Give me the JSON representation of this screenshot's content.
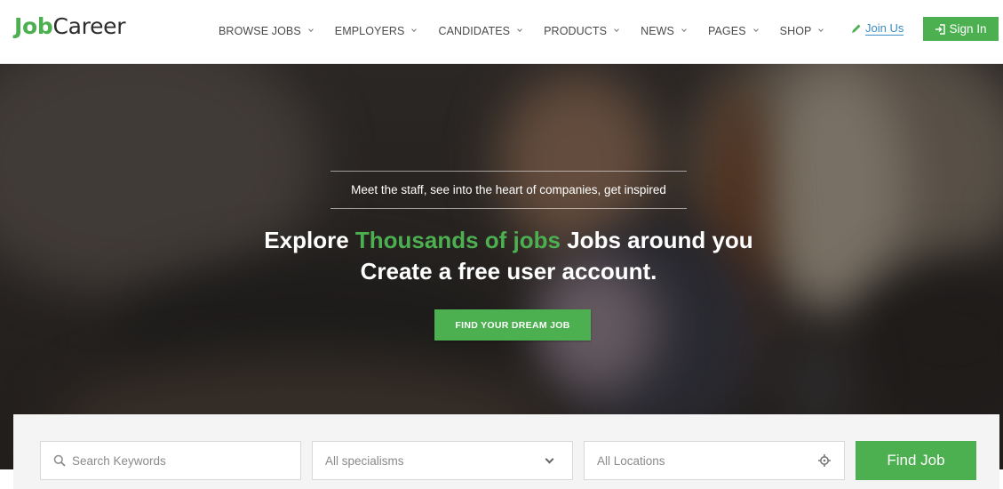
{
  "brand": {
    "logo_part1": "Job",
    "logo_part2": "Career",
    "accent_color": "#4caf50"
  },
  "nav": {
    "items": [
      {
        "label": "BROWSE JOBS"
      },
      {
        "label": "EMPLOYERS"
      },
      {
        "label": "CANDIDATES"
      },
      {
        "label": "PRODUCTS"
      },
      {
        "label": "NEWS"
      },
      {
        "label": "PAGES"
      },
      {
        "label": "SHOP"
      }
    ],
    "join_label": "Join Us",
    "join_icon": "pencil-icon",
    "signin_label": "Sign In",
    "signin_icon": "sign-in-icon"
  },
  "hero": {
    "tagline": "Meet the staff, see into the heart of companies, get inspired",
    "headline_prefix": "Explore ",
    "headline_highlight": "Thousands of jobs",
    "headline_suffix": " Jobs around you",
    "headline_line2": "Create a free user account.",
    "cta_label": "FIND YOUR DREAM JOB"
  },
  "search": {
    "keywords_placeholder": "Search Keywords",
    "keywords_icon": "search-icon",
    "specialism_value": "All specialisms",
    "location_placeholder": "All Locations",
    "location_icon": "crosshair-icon",
    "submit_label": "Find Job"
  }
}
